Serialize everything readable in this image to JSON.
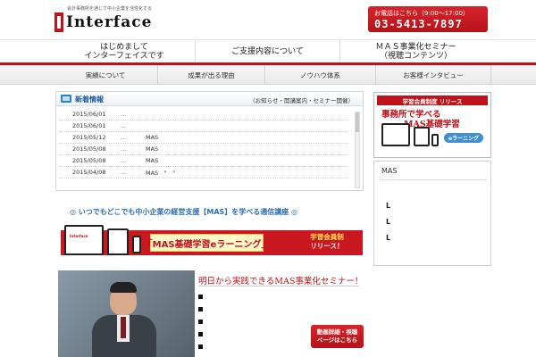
{
  "header": {
    "tagline": "会計事務所を通じて中小企業を活性化する",
    "logo_text": "Interface",
    "contact_label": "お電話はこちら（9:00〜17:00）",
    "phone": "03-5413-7897"
  },
  "main_nav": [
    {
      "line1": "はじめまして",
      "line2": "インターフェイスです"
    },
    {
      "line1": "ご支援内容について",
      "line2": ""
    },
    {
      "line1": "ＭＡＳ事業化セミナー",
      "line2": "（視聴コンテンツ）"
    }
  ],
  "sub_nav": [
    "実績について",
    "成果が出る理由",
    "ノウハウ体系",
    "お客様インタビュー"
  ],
  "news": {
    "title": "新着情報",
    "subtitle": "（お知らせ・開講案内・セミナー開催）",
    "items": [
      {
        "date": "2015/06/01",
        "dots": "...",
        "text": ""
      },
      {
        "date": "2015/06/01",
        "dots": "...",
        "text": ""
      },
      {
        "date": "2015/05/12",
        "dots": "...",
        "text": "MAS"
      },
      {
        "date": "2015/05/08",
        "dots": "...",
        "text": "MAS"
      },
      {
        "date": "2015/05/08",
        "dots": "...",
        "text": "MAS"
      },
      {
        "date": "2015/04/08",
        "dots": "...",
        "text": "MAS　\"　\""
      }
    ]
  },
  "banner1": {
    "text": "◎ いつでもどこでも中小企業の経営支援【MAS】を学べる通信講座 ◎"
  },
  "banner2": {
    "device_logo": "Interface",
    "title": "「MAS基礎学習eラーニング」",
    "side_line1": "学習会員制",
    "side_line2": "リリース！"
  },
  "seminar": {
    "heading": "明日から実践できるMAS事業化セミナー！",
    "button_line1": "動画詳細・視聴",
    "button_line2": "ページはこちら"
  },
  "sidebar": {
    "banner_top": "学習会員制度 リリース",
    "banner_line1": "事務所で学べる",
    "banner_line2": "MAS基礎学習",
    "banner_pill": "eラーニング",
    "box_title": "MAS",
    "letters": [
      "L",
      "L",
      "L"
    ]
  },
  "colors": {
    "brand_red": "#c0121a",
    "link_blue": "#2b6fb3"
  }
}
